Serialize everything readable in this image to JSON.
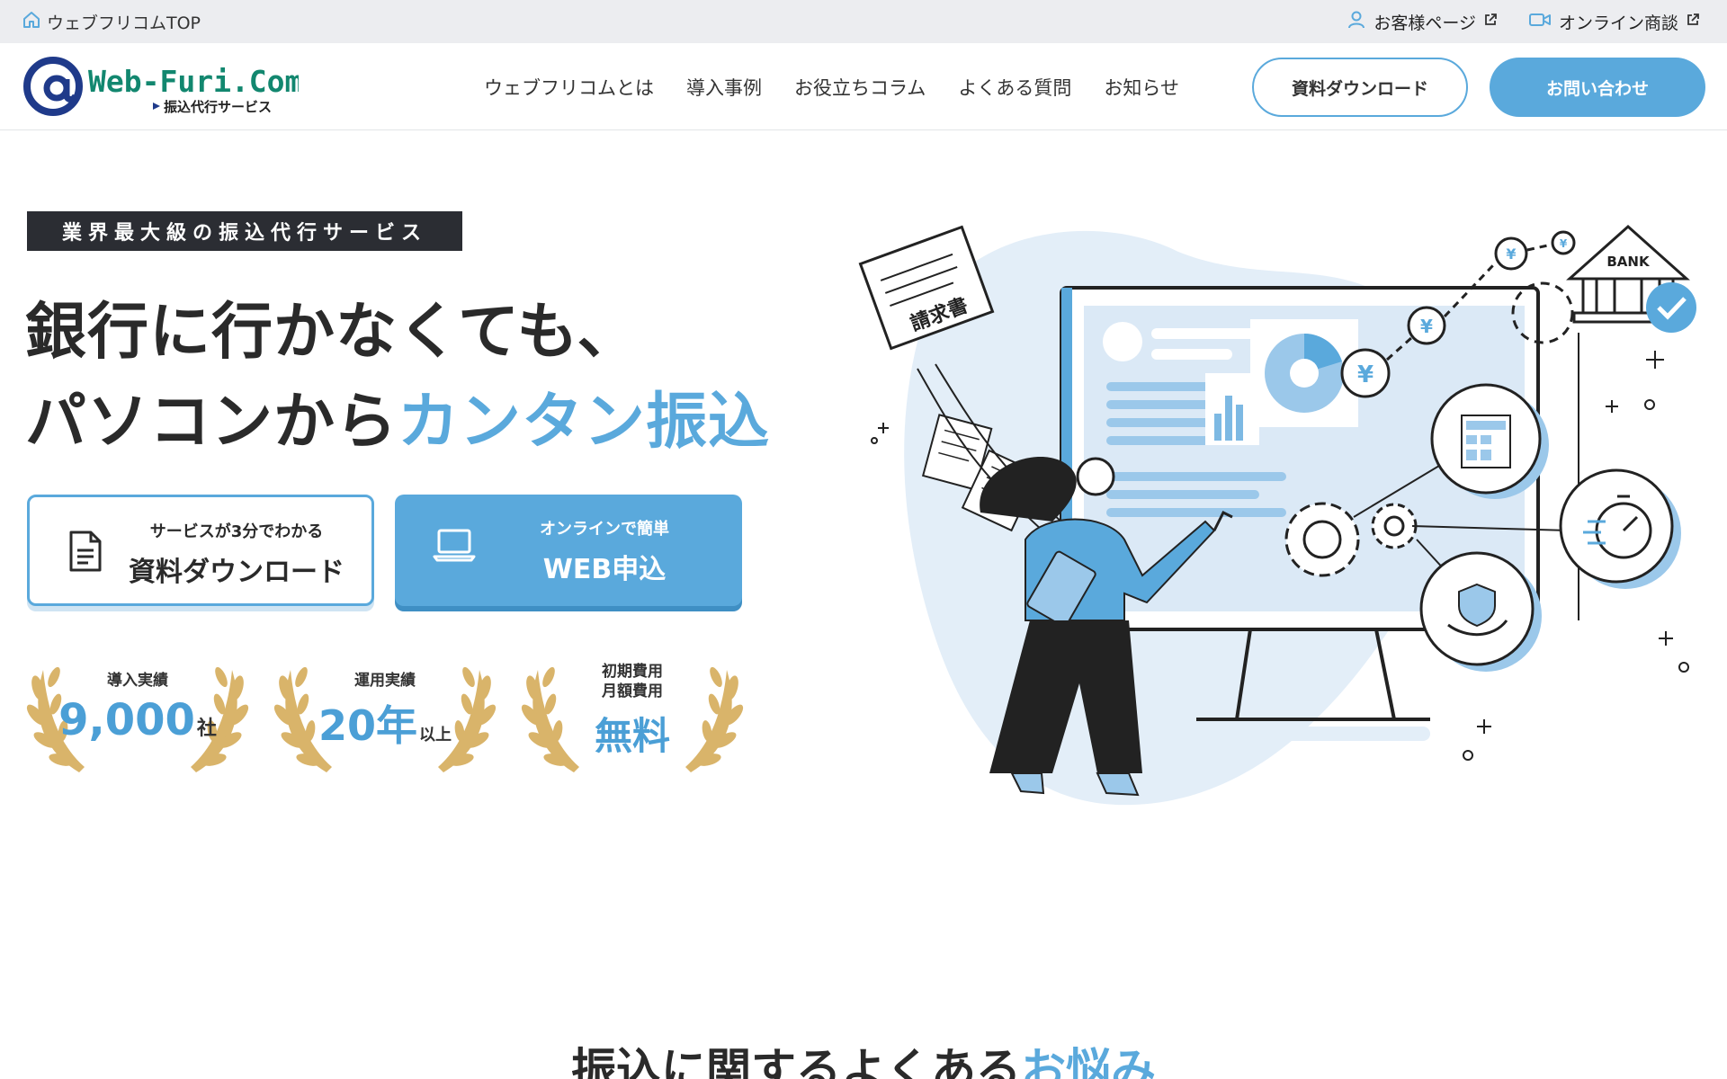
{
  "topbar": {
    "home_label": "ウェブフリコムTOP",
    "customer_label": "お客様ページ",
    "online_label": "オンライン商談"
  },
  "header": {
    "logo_main": "Web-Furi.Com",
    "logo_sub": "振込代行サービス",
    "nav": [
      "ウェブフリコムとは",
      "導入事例",
      "お役立ちコラム",
      "よくある質問",
      "お知らせ"
    ],
    "download_button": "資料ダウンロード",
    "contact_button": "お問い合わせ"
  },
  "hero": {
    "tagline": "業界最大級の振込代行サービス",
    "headline_line1": "銀行に行かなくても、",
    "headline_line2_prefix": "パソコンから",
    "headline_line2_accent": "カンタン振込",
    "cta_doc_small": "サービスが3分でわかる",
    "cta_doc_big": "資料ダウンロード",
    "cta_web_small": "オンラインで簡単",
    "cta_web_big": "WEB申込"
  },
  "badges": [
    {
      "label": "導入実績",
      "value": "9,000",
      "unit": "社"
    },
    {
      "label": "運用実績",
      "value": "20年",
      "unit": "以上"
    },
    {
      "label_line1": "初期費用",
      "label_line2": "月額費用",
      "value": "無料"
    }
  ],
  "illustration": {
    "invoice_text": "請求書",
    "bank_text": "BANK",
    "yen": "¥"
  },
  "section": {
    "title_prefix": "振込に関するよくある",
    "title_accent": "お悩み"
  },
  "colors": {
    "accent": "#5aa9dc",
    "dark": "#2b2d33",
    "topbar_bg": "#ecedf0"
  }
}
